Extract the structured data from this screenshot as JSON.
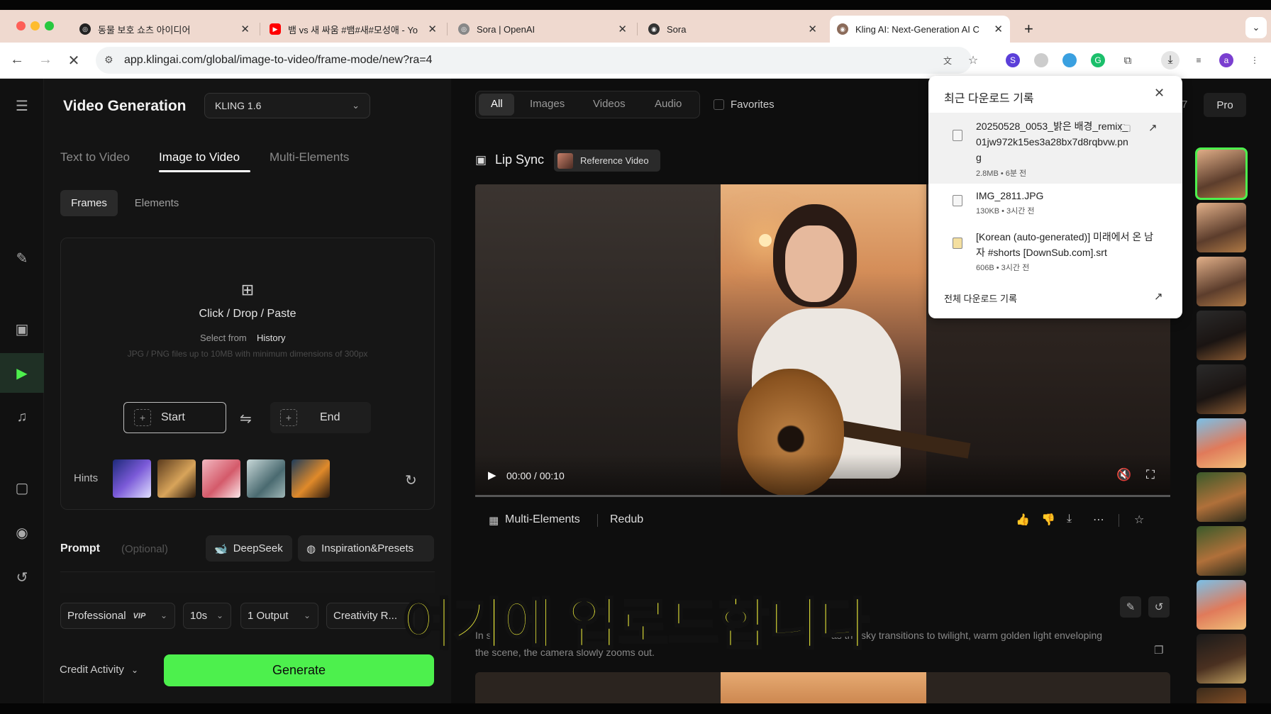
{
  "browser": {
    "tabs": [
      {
        "title": "동물 보호 쇼츠 아이디어",
        "active": false
      },
      {
        "title": "뱀 vs 새 싸움 #뱀#새#모성애 - Yo",
        "active": false
      },
      {
        "title": "Sora | OpenAI",
        "active": false
      },
      {
        "title": "Sora",
        "active": false
      },
      {
        "title": "Kling AI: Next-Generation AI C",
        "active": true
      }
    ],
    "new_tab": "+",
    "url": "app.klingai.com/global/image-to-video/frame-mode/new?ra=4",
    "profile_initial": "a"
  },
  "app": {
    "title": "Video Generation",
    "model": "KLING 1.6",
    "mode_tabs": [
      "Text to Video",
      "Image to Video",
      "Multi-Elements"
    ],
    "active_mode": "Image to Video",
    "sub_tabs": [
      "Frames",
      "Elements"
    ],
    "upload": {
      "primary": "Click / Drop / Paste",
      "select_from": "Select from",
      "history": "History",
      "limits": "JPG / PNG files up to 10MB with minimum dimensions of 300px"
    },
    "start_label": "Start",
    "end_label": "End",
    "hints_label": "Hints",
    "prompt_label": "Prompt",
    "prompt_optional": "(Optional)",
    "deepseek_label": "DeepSeek",
    "inspiration_label": "Inspiration&Presets",
    "options": {
      "mode": "Professional",
      "mode_badge": "VIP",
      "duration": "10s",
      "outputs": "1 Output",
      "creativity": "Creativity R..."
    },
    "credit_label": "Credit Activity",
    "generate_label": "Generate"
  },
  "gallery": {
    "filters": [
      "All",
      "Images",
      "Videos",
      "Audio"
    ],
    "active_filter": "All",
    "favorites_label": "Favorites",
    "count_partial": "7",
    "pro_label": "Pro",
    "lip_sync_label": "Lip Sync",
    "reference_video_label": "Reference Video",
    "time_display": "00:00 / 00:10",
    "multi_elements_label": "Multi-Elements",
    "redub_label": "Redub",
    "description_left": "In st",
    "description_right": "as the sky transitions to twilight, warm golden light enveloping",
    "description_line2": "the scene, the camera slowly zooms out."
  },
  "subtitle": "여기에 업로드합니다",
  "downloads": {
    "title": "최근 다운로드 기록",
    "items": [
      {
        "name": "20250528_0053_밝은 배경_remix_01jw972k15es3a28bx7d8rqbvw.png",
        "meta": "2.8MB • 6분 전"
      },
      {
        "name": "IMG_2811.JPG",
        "meta": "130KB • 3시간 전"
      },
      {
        "name": "[Korean (auto-generated)] 미래에서 온 남자 #shorts [DownSub.com].srt",
        "meta": "606B • 3시간 전"
      }
    ],
    "all_label": "전체 다운로드 기록"
  },
  "colors": {
    "accent_green": "#4df04d",
    "subtitle_yellow": "#ffff3d",
    "tab_bar": "#efd9cf"
  }
}
